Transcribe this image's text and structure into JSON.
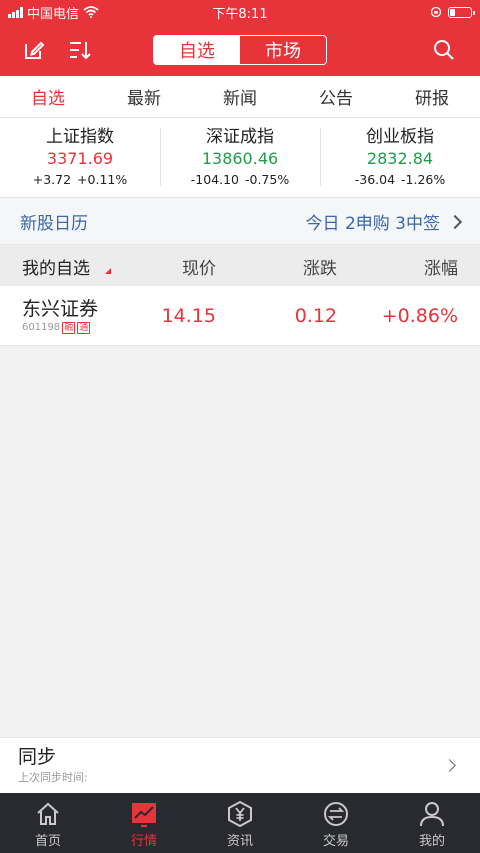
{
  "status": {
    "carrier": "中国电信",
    "time": "下午8:11"
  },
  "nav": {
    "segments": [
      {
        "label": "自选"
      },
      {
        "label": "市场"
      }
    ]
  },
  "tabs": [
    {
      "label": "自选"
    },
    {
      "label": "最新"
    },
    {
      "label": "新闻"
    },
    {
      "label": "公告"
    },
    {
      "label": "研报"
    }
  ],
  "indices": [
    {
      "name": "上证指数",
      "value": "3371.69",
      "change": "+3.72",
      "percent": "+0.11%"
    },
    {
      "name": "深证成指",
      "value": "13860.46",
      "change": "-104.10",
      "percent": "-0.75%"
    },
    {
      "name": "创业板指",
      "value": "2832.84",
      "change": "-36.04",
      "percent": "-1.26%"
    }
  ],
  "ipo": {
    "title": "新股日历",
    "summary": "今日 2申购 3中签"
  },
  "table": {
    "headers": {
      "name": "我的自选",
      "price": "现价",
      "change": "涨跌",
      "percent": "涨幅"
    },
    "rows": [
      {
        "name": "东兴证券",
        "code": "601198",
        "tag": "融",
        "tag2": "通",
        "price": "14.15",
        "change": "0.12",
        "percent": "+0.86%"
      }
    ]
  },
  "sync": {
    "title": "同步",
    "subtitle": "上次同步时间:"
  },
  "tabbar": [
    {
      "label": "首页"
    },
    {
      "label": "行情"
    },
    {
      "label": "资讯"
    },
    {
      "label": "交易"
    },
    {
      "label": "我的"
    }
  ],
  "colors": {
    "brand_red": "#e8333b",
    "up": "#e8333b",
    "down": "#1f9e4a",
    "link": "#3a67a8",
    "tabbar_bg": "#292a2f"
  }
}
